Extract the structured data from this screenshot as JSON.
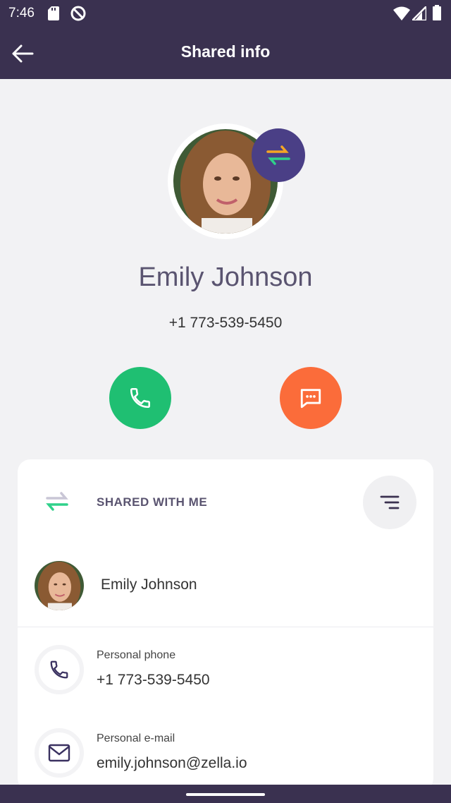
{
  "status_bar": {
    "time": "7:46",
    "icons": [
      "sd-card-icon",
      "do-not-disturb-icon",
      "wifi-icon",
      "signal-icon",
      "battery-icon"
    ]
  },
  "app_bar": {
    "title": "Shared info",
    "back_icon": "arrow-back-icon"
  },
  "profile": {
    "name": "Emily Johnson",
    "phone": "+1 773-539-5450",
    "badge_icon": "share-swap-icon"
  },
  "actions": {
    "call_icon": "phone-icon",
    "message_icon": "chat-icon"
  },
  "shared_section": {
    "title": "SHARED WITH ME",
    "icon": "share-swap-icon",
    "filter_icon": "sort-filter-icon",
    "owner_name": "Emily Johnson",
    "fields": [
      {
        "label": "Personal phone",
        "value": "+1 773-539-5450",
        "icon": "phone-icon"
      },
      {
        "label": "Personal e-mail",
        "value": "emily.johnson@zella.io",
        "icon": "mail-icon"
      }
    ]
  },
  "colors": {
    "bar": "#3a3150",
    "call": "#1fbf72",
    "message": "#fb6c3a",
    "badge": "#4a3f86"
  }
}
